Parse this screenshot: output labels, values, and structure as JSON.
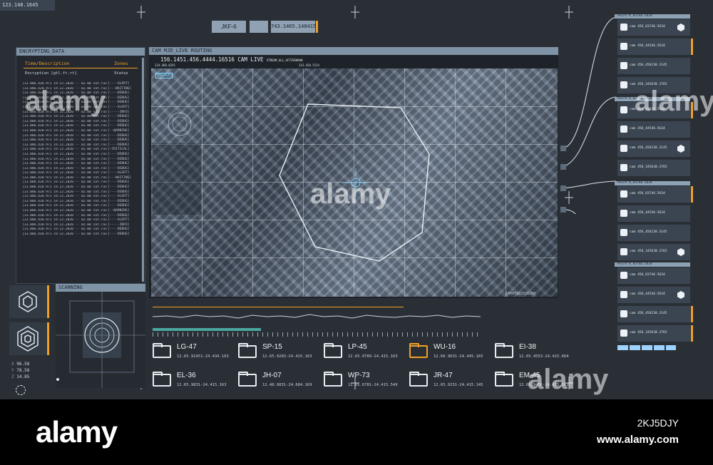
{
  "top_left_coords": "123.148.1645",
  "top_tabs": [
    "JKF-6",
    "",
    "743.1465.148415"
  ],
  "log_panel": {
    "title": "ENCRYPTING_DATA",
    "col1": "Time/Description",
    "col2": "Zones",
    "sub1": "Encryption [gtl.fr.rt]",
    "sub2": "Status",
    "rows": [
      [
        "[13.006.420.971 19.12.2020 -- 02.00 sat.run]",
        "[----ALERT]"
      ],
      [
        "[13.006.420.971 19.12.2020 -- 02.00 sat.run]",
        "[---WAITING]"
      ],
      [
        "[13.006.420.971 19.12.2020 -- 02.00 sat.run]",
        "[----DEBUG]"
      ],
      [
        "[13.006.420.971 19.12.2020 -- 02.00 sat.run]",
        "[----DEBUG]"
      ],
      [
        "[13.006.420.971 19.12.2020 -- 02.00 sat.run]",
        "[----DEBUG]"
      ],
      [
        "[13.006.420.971 19.12.2020 -- 02.00 sat.run]",
        "[----ALERT]"
      ],
      [
        "[13.006.420.971 19.12.2020 -- 02.00 sat.run]",
        "[-----INFO]"
      ],
      [
        "[13.006.420.971 19.12.2020 -- 02.00 sat.run]",
        "[----DEBUG]"
      ],
      [
        "[13.006.420.971 19.12.2020 -- 02.00 sat.run]",
        "[----DEBUG]"
      ],
      [
        "[13.006.420.971 19.12.2020 -- 02.00 sat.run]",
        "[----DEBUG]"
      ],
      [
        "[13.006.420.971 19.12.2020 -- 02.00 sat.run]",
        "[--WARNING]"
      ],
      [
        "[13.006.420.971 19.12.2020 -- 02.00 sat.run]",
        "[----DEBUG]"
      ],
      [
        "[13.006.420.971 19.12.2020 -- 02.00 sat.run]",
        "[----DEBUG]"
      ],
      [
        "[13.006.420.971 19.12.2020 -- 02.00 sat.run]",
        "[----DEBUG]"
      ],
      [
        "[13.006.420.971 19.12.2020 -- 02.00 sat.run]",
        "[-CRITICAL]"
      ],
      [
        "[13.006.420.971 19.12.2020 -- 02.00 sat.run]",
        "[----DEBUG]"
      ],
      [
        "[13.006.420.971 19.12.2020 -- 02.00 sat.run]",
        "[----DEBUG]"
      ],
      [
        "[13.006.420.971 19.12.2020 -- 02.00 sat.run]",
        "[----DEBUG]"
      ],
      [
        "[13.006.420.971 19.12.2020 -- 02.00 sat.run]",
        "[----DEBUG]"
      ],
      [
        "[13.006.420.971 19.12.2020 -- 02.00 sat.run]",
        "[----ALERT]"
      ],
      [
        "[13.006.420.971 19.12.2020 -- 02.00 sat.run]",
        "[---WAITING]"
      ],
      [
        "[13.006.420.971 19.12.2020 -- 02.00 sat.run]",
        "[----DEBUG]"
      ],
      [
        "[13.006.420.971 19.12.2020 -- 02.00 sat.run]",
        "[----DEBUG]"
      ],
      [
        "[13.006.420.971 19.12.2020 -- 02.00 sat.run]",
        "[----DEBUG]"
      ],
      [
        "[13.006.420.971 19.12.2020 -- 02.00 sat.run]",
        "[----ALERT]"
      ],
      [
        "[13.006.420.971 19.12.2020 -- 02.00 sat.run]",
        "[----DEBUG]"
      ],
      [
        "[13.006.420.971 19.12.2020 -- 02.00 sat.run]",
        "[----DEBUG]"
      ],
      [
        "[13.006.420.971 19.12.2020 -- 02.00 sat.run]",
        "[--WARNING]"
      ],
      [
        "[13.006.420.971 19.12.2020 -- 02.00 sat.run]",
        "[----DEBUG]"
      ],
      [
        "[13.006.420.971 19.12.2020 -- 02.00 sat.run]",
        "[----ALERT]"
      ],
      [
        "[13.006.420.971 19.12.2020 -- 02.00 sat.run]",
        "[-----INFO]"
      ],
      [
        "[13.006.420.971 19.12.2020 -- 02.00 sat.run]",
        "[----DEBUG]"
      ],
      [
        "[13.006.420.971 19.12.2020 -- 02.00 sat.run]",
        "[----DEBUG]"
      ]
    ]
  },
  "camera": {
    "title": "CAM MJD_LIVE ROUTING",
    "header": "156.1451.456.4444.16516 CAM LIVE",
    "stream": "STREAM_ALL_ACTIVEW940",
    "coord_left": "234.408.0291",
    "coord_right": "243.450.5154",
    "engage": "ENGAGE",
    "footer_id": "10097183326260"
  },
  "scanning": {
    "title": "SCANNING",
    "readouts": [
      {
        "label": "X",
        "value": "96.58"
      },
      {
        "label": "Y",
        "value": "78.58"
      },
      {
        "label": "Z",
        "value": "14.85"
      }
    ]
  },
  "folders": [
    {
      "name": "LG-47",
      "coord": "12.65.91451-24.434.163",
      "highlight": false
    },
    {
      "name": "SP-15",
      "coord": "12.65.9283-24.415.163",
      "highlight": false
    },
    {
      "name": "LP-45",
      "coord": "12.65.9789-24.415.163",
      "highlight": false
    },
    {
      "name": "WU-16",
      "coord": "12.66.9631-24.445.165",
      "highlight": true
    },
    {
      "name": "EI-38",
      "coord": "12.65.4553-24.415.664",
      "highlight": false
    },
    {
      "name": "EL-36",
      "coord": "12.65.9831-24.415.163",
      "highlight": false
    },
    {
      "name": "JH-07",
      "coord": "12.48.9831-24.684.169",
      "highlight": false
    },
    {
      "name": "WP-73",
      "coord": "12.65.6781-24.415.549",
      "highlight": false
    },
    {
      "name": "JR-47",
      "coord": "12.65.9231-24.415.145",
      "highlight": false
    },
    {
      "name": "EM-45",
      "coord": "12.65.9456-24.415.163",
      "highlight": false
    }
  ],
  "cam_groups": [
    {
      "header": "Point K_83746.5634",
      "items": [
        {
          "label": "cam 456_83746.5634",
          "bar": false,
          "hex": true
        },
        {
          "label": "cam 456_44546.5634",
          "bar": true,
          "hex": false
        },
        {
          "label": "cam 456_456238.3145",
          "bar": false,
          "hex": false
        },
        {
          "label": "cam 456_345638.3765",
          "bar": false,
          "hex": false
        }
      ]
    },
    {
      "header": "Point K_83746.5634",
      "items": [
        {
          "label": "cam 456_83746.5634",
          "bar": true,
          "hex": false
        },
        {
          "label": "cam 456_44546.5634",
          "bar": false,
          "hex": false
        },
        {
          "label": "cam 456_456238.3145",
          "bar": false,
          "hex": true
        },
        {
          "label": "cam 456_345638.3765",
          "bar": false,
          "hex": false
        }
      ]
    },
    {
      "header": "Point K_83746.5634",
      "items": [
        {
          "label": "cam 456_83746.5634",
          "bar": true,
          "hex": false
        },
        {
          "label": "cam 456_44546.5634",
          "bar": false,
          "hex": false
        },
        {
          "label": "cam 456_456238.3145",
          "bar": false,
          "hex": false
        },
        {
          "label": "cam 456_345638.3765",
          "bar": false,
          "hex": true
        }
      ]
    },
    {
      "header": "Point K_83746.5634",
      "items": [
        {
          "label": "cam 456_83746.5634",
          "bar": false,
          "hex": false
        },
        {
          "label": "cam 456_44546.5634",
          "bar": false,
          "hex": true
        },
        {
          "label": "cam 456_456238.3145",
          "bar": true,
          "hex": false
        },
        {
          "label": "cam 456_345638.3765",
          "bar": true,
          "hex": false
        }
      ]
    }
  ],
  "watermarks": [
    "alamy",
    "www.alamy.com",
    "2KJ5DJY"
  ],
  "colors": {
    "accent": "#f0a028",
    "panel": "#25292f",
    "bar": "#7f93a6"
  }
}
